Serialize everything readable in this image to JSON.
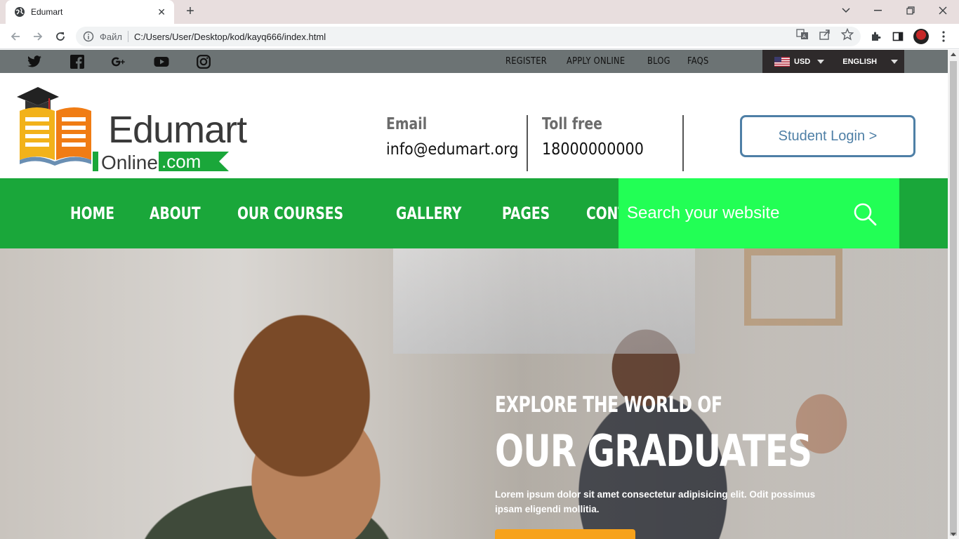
{
  "browser": {
    "tab_title": "Edumart",
    "new_tab_label": "+",
    "scheme_label": "Файл",
    "url": "C:/Users/User/Desktop/kod/kayq666/index.html"
  },
  "topbar": {
    "social_icons": [
      "twitter-icon",
      "facebook-icon",
      "google-plus-icon",
      "youtube-icon",
      "instagram-icon"
    ],
    "links": [
      "REGISTER",
      "APPLY ONLINE",
      "BLOG",
      "FAQS"
    ],
    "currency": "USD",
    "language": "ENGLISH"
  },
  "header": {
    "logo": {
      "word": "Edumart",
      "online": "Online",
      "com": ".com"
    },
    "email_label": "Email",
    "email_value": "info@edumart.org",
    "phone_label": "Toll free",
    "phone_value": "18000000000",
    "login_label": "Student Login >"
  },
  "nav": {
    "items": [
      "HOME",
      "ABOUT",
      "OUR COURSES",
      "GALLERY",
      "PAGES",
      "CONTACT"
    ],
    "search_placeholder": "Search your website"
  },
  "hero": {
    "subtitle": "EXPLORE THE WORLD OF",
    "title": "OUR GRADUATES",
    "text": "Lorem ipsum dolor sit amet consectetur adipisicing elit. Odit possimus ipsam eligendi mollitia."
  },
  "colors": {
    "brand_green": "#1aa73a",
    "search_green": "#22ff55",
    "login_blue": "#4e7fa6",
    "topbar_gray": "#6c7374",
    "hero_button": "#f7a21b"
  }
}
